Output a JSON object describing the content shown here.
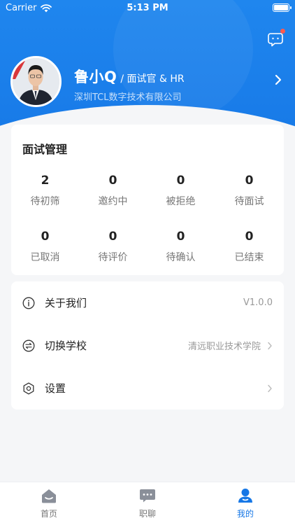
{
  "status_bar": {
    "carrier": "Carrier",
    "time": "5:13 PM"
  },
  "profile": {
    "name": "鲁小Q",
    "role": "/ 面试官 & HR",
    "company": "深圳TCL数字技术有限公司"
  },
  "interview": {
    "title": "面试管理",
    "stats": [
      {
        "value": "2",
        "label": "待初筛"
      },
      {
        "value": "0",
        "label": "邀约中"
      },
      {
        "value": "0",
        "label": "被拒绝"
      },
      {
        "value": "0",
        "label": "待面试"
      },
      {
        "value": "0",
        "label": "已取消"
      },
      {
        "value": "0",
        "label": "待评价"
      },
      {
        "value": "0",
        "label": "待确认"
      },
      {
        "value": "0",
        "label": "已结束"
      }
    ]
  },
  "menu": {
    "about": {
      "label": "关于我们",
      "value": "V1.0.0",
      "icon": "info-icon"
    },
    "switch_school": {
      "label": "切换学校",
      "value": "清远职业技术学院",
      "icon": "switch-icon"
    },
    "settings": {
      "label": "设置",
      "icon": "settings-icon"
    }
  },
  "tabbar": {
    "home": "首页",
    "chat": "职聊",
    "mine": "我的"
  },
  "colors": {
    "accent": "#1677e6",
    "badge": "#ff5a4e"
  }
}
